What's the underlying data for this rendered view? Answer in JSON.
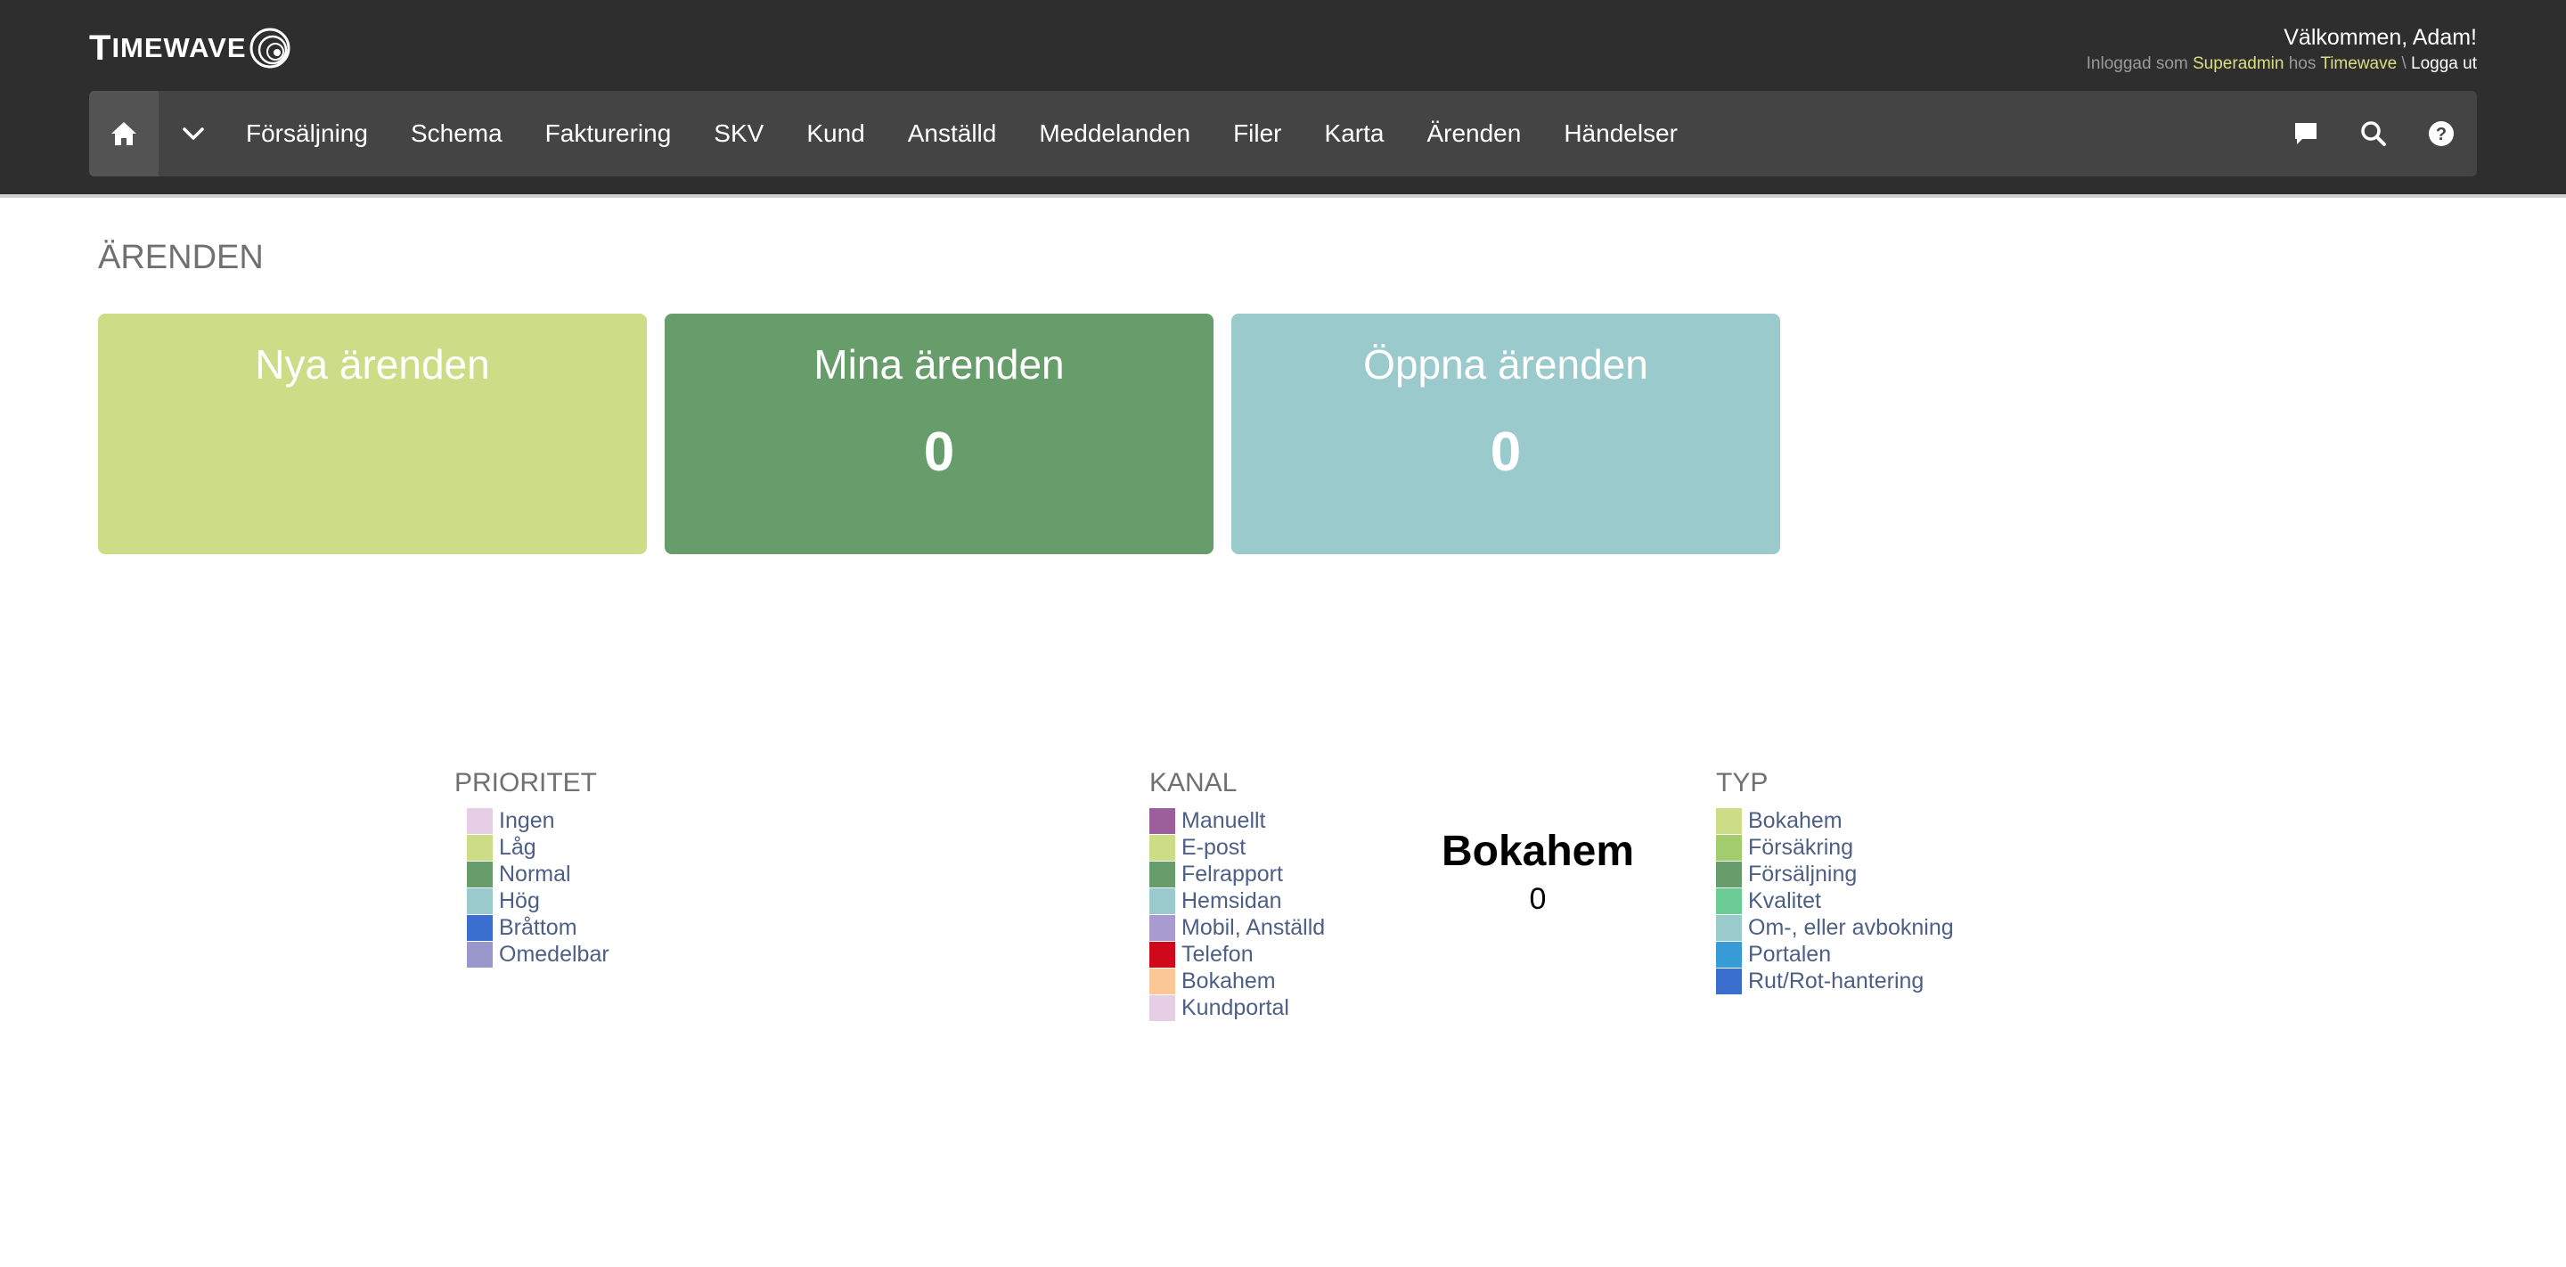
{
  "header": {
    "logo_cap": "T",
    "logo_rest": "IMEWAVE",
    "welcome": "Välkommen, Adam!",
    "login_prefix": "Inloggad som",
    "login_role": "Superadmin",
    "login_mid": "hos",
    "login_company": "Timewave",
    "login_sep": "\\",
    "logout": "Logga ut"
  },
  "nav": {
    "items": [
      "Försäljning",
      "Schema",
      "Fakturering",
      "SKV",
      "Kund",
      "Anställd",
      "Meddelanden",
      "Filer",
      "Karta",
      "Ärenden",
      "Händelser"
    ]
  },
  "page": {
    "title": "ÄRENDEN"
  },
  "cards": [
    {
      "title": "Nya ärenden",
      "value": "",
      "color": "#cddd87"
    },
    {
      "title": "Mina ärenden",
      "value": "0",
      "color": "#679d6a"
    },
    {
      "title": "Öppna ärenden",
      "value": "0",
      "color": "#9bcacc"
    }
  ],
  "legends": {
    "prioritet": {
      "title": "PRIORITET",
      "items": [
        {
          "label": "Ingen",
          "color": "#e6cfe5"
        },
        {
          "label": "Låg",
          "color": "#cddd87"
        },
        {
          "label": "Normal",
          "color": "#679d6a"
        },
        {
          "label": "Hög",
          "color": "#9bcacc"
        },
        {
          "label": "Bråttom",
          "color": "#3a6fd0"
        },
        {
          "label": "Omedelbar",
          "color": "#9898cc"
        }
      ]
    },
    "kanal": {
      "title": "KANAL",
      "items": [
        {
          "label": "Manuellt",
          "color": "#9c5f9c"
        },
        {
          "label": "E-post",
          "color": "#cddd87"
        },
        {
          "label": "Felrapport",
          "color": "#679d6a"
        },
        {
          "label": "Hemsidan",
          "color": "#9bcacc"
        },
        {
          "label": "Mobil, Anställd",
          "color": "#a89bcf"
        },
        {
          "label": "Telefon",
          "color": "#d0081b"
        },
        {
          "label": "Bokahem",
          "color": "#fcc797"
        },
        {
          "label": "Kundportal",
          "color": "#e6cfe5"
        }
      ]
    },
    "typ": {
      "title": "TYP",
      "items": [
        {
          "label": "Bokahem",
          "color": "#cddd87"
        },
        {
          "label": "Försäkring",
          "color": "#a2cc6e"
        },
        {
          "label": "Försäljning",
          "color": "#679d6a"
        },
        {
          "label": "Kvalitet",
          "color": "#6ccc96"
        },
        {
          "label": "Om-, eller avbokning",
          "color": "#9bcacc"
        },
        {
          "label": "Portalen",
          "color": "#379cd6"
        },
        {
          "label": "Rut/Rot-hantering",
          "color": "#3a6fd0"
        }
      ]
    }
  },
  "center": {
    "title": "Bokahem",
    "value": "0"
  },
  "icons": [
    "home-icon",
    "chevron-down-icon",
    "chat-icon",
    "search-icon",
    "help-icon"
  ]
}
